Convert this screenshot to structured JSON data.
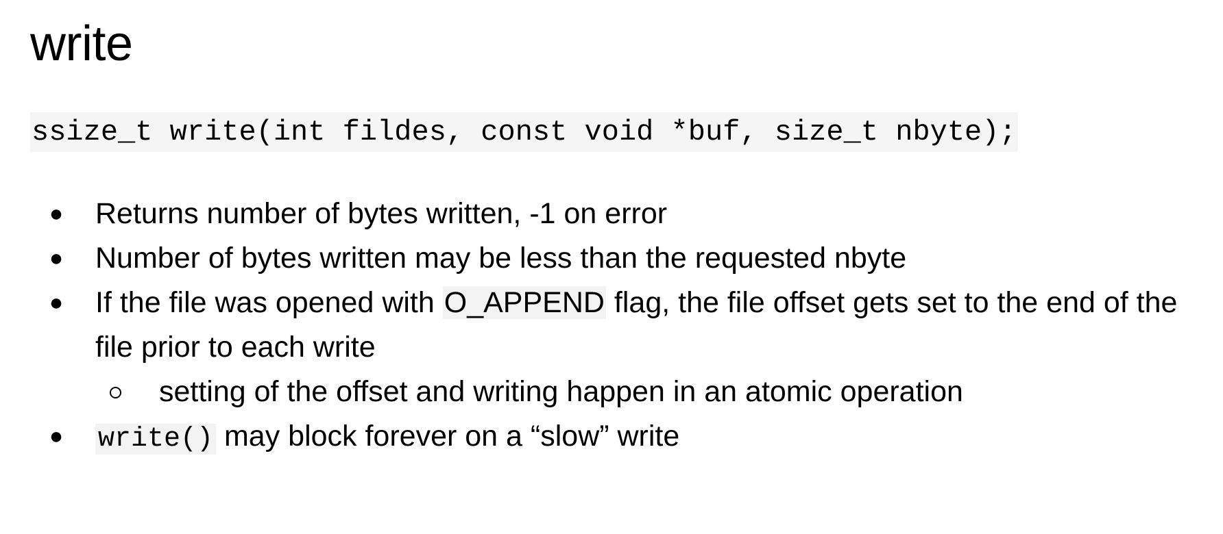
{
  "slide": {
    "title": "write",
    "signature": "ssize_t write(int fildes, const void *buf, size_t nbyte);",
    "bullets": [
      {
        "text": "Returns number of bytes written, -1 on error"
      },
      {
        "text": "Number of bytes written may be less than the requested nbyte"
      },
      {
        "before": "If the file was opened with ",
        "code": "O_APPEND",
        "after": " flag, the file offset gets set to the end of the file prior to each write"
      },
      {
        "sub": "setting of the offset and writing happen in an atomic operation"
      },
      {
        "code": "write()",
        "after": " may block forever on a “slow” write"
      }
    ]
  }
}
